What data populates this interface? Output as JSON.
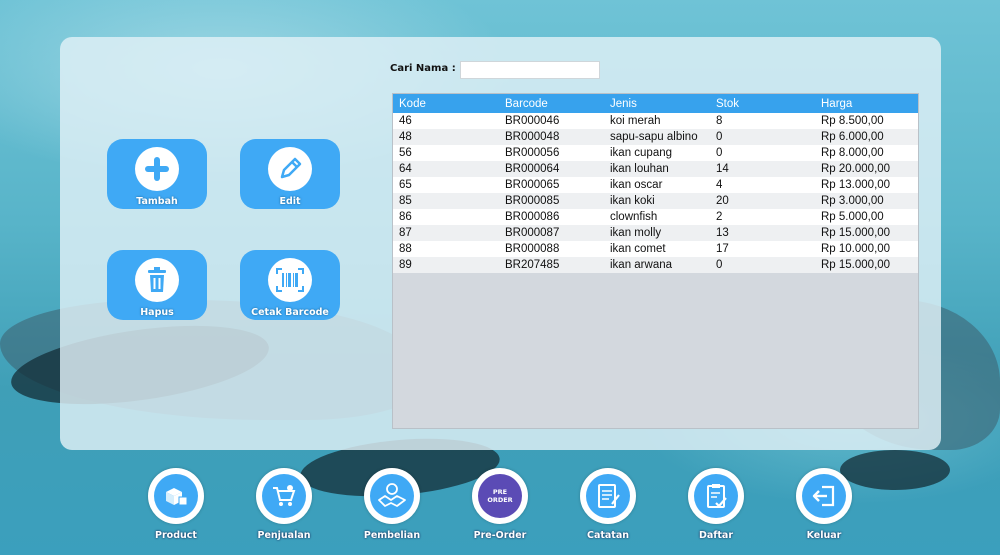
{
  "search": {
    "label": "Cari Nama :",
    "value": "",
    "placeholder": ""
  },
  "actions": {
    "tambah": "Tambah",
    "edit": "Edit",
    "hapus": "Hapus",
    "cetak": "Cetak Barcode"
  },
  "table": {
    "headers": [
      "Kode",
      "Barcode",
      "Jenis",
      "Stok",
      "Harga"
    ],
    "rows": [
      [
        "46",
        "BR000046",
        "koi merah",
        "8",
        "Rp 8.500,00"
      ],
      [
        "48",
        "BR000048",
        "sapu-sapu albino",
        "0",
        "Rp 6.000,00"
      ],
      [
        "56",
        "BR000056",
        "ikan cupang",
        "0",
        "Rp 8.000,00"
      ],
      [
        "64",
        "BR000064",
        "ikan louhan",
        "14",
        "Rp 20.000,00"
      ],
      [
        "65",
        "BR000065",
        "ikan oscar",
        "4",
        "Rp 13.000,00"
      ],
      [
        "85",
        "BR000085",
        "ikan koki",
        "20",
        "Rp 3.000,00"
      ],
      [
        "86",
        "BR000086",
        "clownfish",
        "2",
        "Rp 5.000,00"
      ],
      [
        "87",
        "BR000087",
        "ikan molly",
        "13",
        "Rp 15.000,00"
      ],
      [
        "88",
        "BR000088",
        "ikan comet",
        "17",
        "Rp 10.000,00"
      ],
      [
        "89",
        "BR207485",
        "ikan arwana",
        "0",
        "Rp 15.000,00"
      ]
    ]
  },
  "nav": {
    "product": "Product",
    "penjualan": "Penjualan",
    "pembelian": "Pembelian",
    "preorder": "Pre-Order",
    "preorder_badge": "PRE ORDER",
    "catatan": "Catatan",
    "daftar": "Daftar",
    "keluar": "Keluar"
  },
  "colors": {
    "accent": "#3fa9f5",
    "table_header": "#37a2ed"
  }
}
